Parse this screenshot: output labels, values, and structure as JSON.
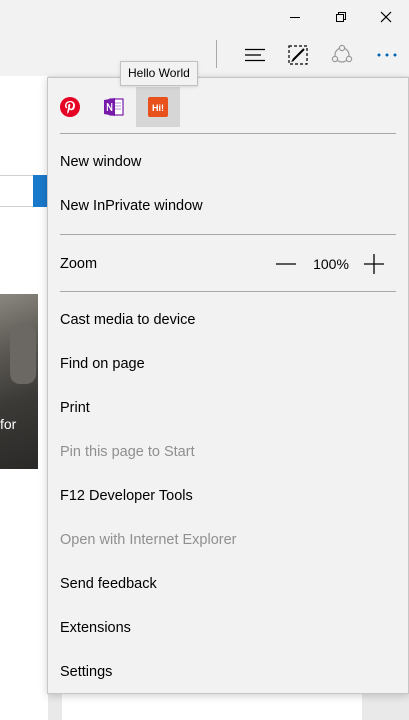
{
  "window_controls": {
    "minimize_icon": "minimize-icon",
    "restore_icon": "restore-icon",
    "close_icon": "close-icon"
  },
  "toolbar": {
    "hub_icon": "hub-icon",
    "web_note_icon": "web-note-icon",
    "share_icon": "share-icon",
    "more_icon": "more-icon",
    "accent_color": "#0063b1"
  },
  "page_behind": {
    "visible_fragment_text": "for"
  },
  "tooltip": {
    "text": "Hello World"
  },
  "extensions": [
    {
      "name": "Pinterest",
      "icon": "pinterest-icon",
      "color": "#e60023"
    },
    {
      "name": "OneNote",
      "icon": "onenote-icon",
      "color": "#7719aa"
    },
    {
      "name": "Hello World",
      "icon": "hello-world-icon",
      "color": "#e8501c",
      "label": "Hi!"
    }
  ],
  "menu": {
    "new_window": "New window",
    "new_inprivate_window": "New InPrivate window",
    "zoom_label": "Zoom",
    "zoom_value": "100%",
    "cast_media": "Cast media to device",
    "find_on_page": "Find on page",
    "print": "Print",
    "pin_to_start": "Pin this page to Start",
    "dev_tools": "F12 Developer Tools",
    "open_with_ie": "Open with Internet Explorer",
    "send_feedback": "Send feedback",
    "extensions": "Extensions",
    "settings": "Settings"
  }
}
